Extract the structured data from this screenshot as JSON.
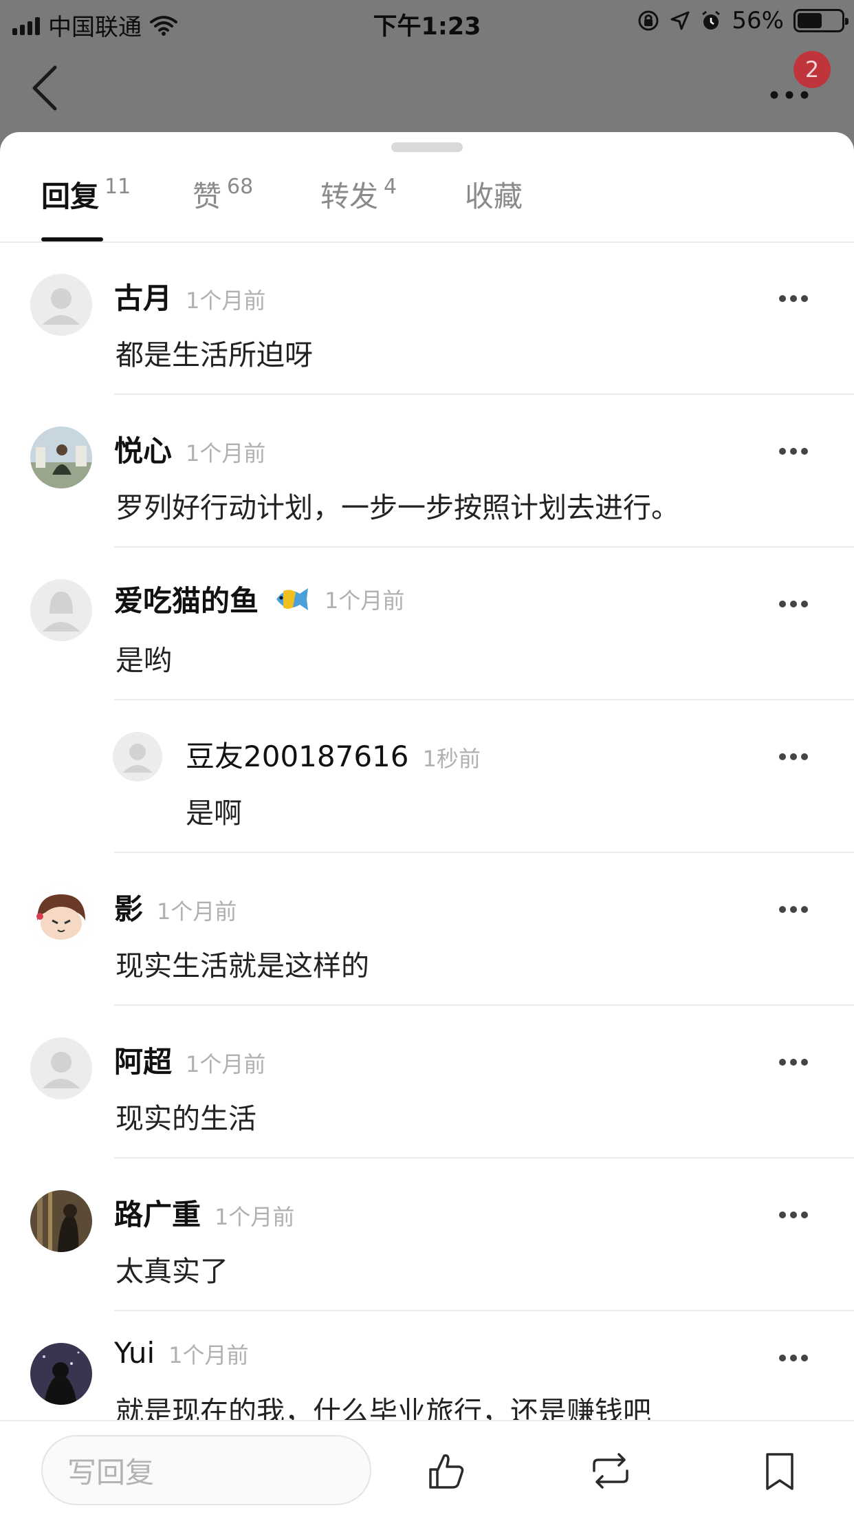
{
  "status_bar": {
    "carrier": "中国联通",
    "time": "下午1:23",
    "battery_percent": "56%",
    "battery_level": 0.56
  },
  "nav": {
    "back_icon": "chevron-left-icon",
    "more_icon": "more-horizontal-icon",
    "badge_count": "2"
  },
  "tabs": [
    {
      "label": "回复",
      "count": "11",
      "active": true
    },
    {
      "label": "赞",
      "count": "68",
      "active": false
    },
    {
      "label": "转发",
      "count": "4",
      "active": false
    },
    {
      "label": "收藏",
      "count": "",
      "active": false
    }
  ],
  "comments": [
    {
      "name": "古月",
      "time": "1个月前",
      "text": "都是生活所迫呀",
      "avatar": "default-avatar"
    },
    {
      "name": "悦心",
      "time": "1个月前",
      "text": "罗列好行动计划，一步一步按照计划去进行。",
      "avatar": "photo-avatar"
    },
    {
      "name": "爱吃猫的鱼",
      "time": "1个月前",
      "text": "是哟",
      "avatar": "default-female-avatar",
      "name_emoji": "tropical-fish-icon"
    },
    {
      "name": "豆友200187616",
      "time": "1秒前",
      "text": "是啊",
      "avatar": "default-avatar",
      "nested": true
    },
    {
      "name": "影",
      "time": "1个月前",
      "text": "现实生活就是这样的",
      "avatar": "cartoon-girl-avatar"
    },
    {
      "name": "阿超",
      "time": "1个月前",
      "text": "现实的生活",
      "avatar": "default-avatar"
    },
    {
      "name": "路广重",
      "time": "1个月前",
      "text": "太真实了",
      "avatar": "photo-avatar-dark"
    },
    {
      "name": "Yui",
      "time": "1个月前",
      "text": "就是现在的我，什么毕业旅行，还是赚钱吧",
      "avatar": "photo-avatar-night"
    }
  ],
  "bottom_bar": {
    "reply_placeholder": "写回复",
    "like_icon": "thumbs-up-icon",
    "repost_icon": "repost-icon",
    "bookmark_icon": "bookmark-icon"
  }
}
